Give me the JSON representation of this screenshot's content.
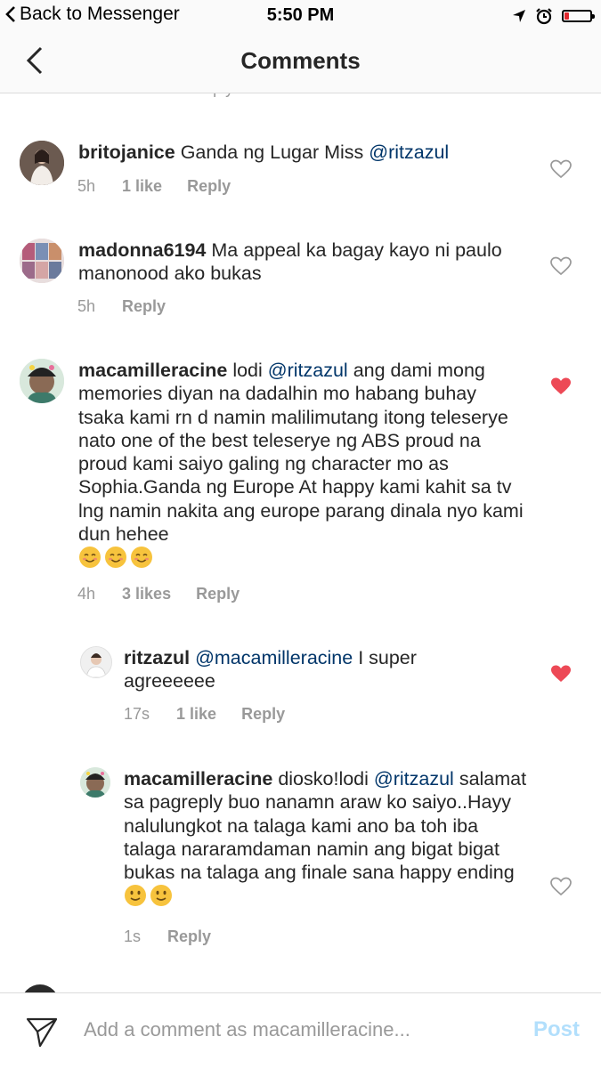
{
  "status_bar": {
    "back_label": "Back to Messenger",
    "time": "5:50 PM"
  },
  "header": {
    "title": "Comments"
  },
  "peek": {
    "ts": "5h",
    "likes": "1 like",
    "reply": "Reply"
  },
  "comments": [
    {
      "username": "britojanice",
      "text_before": "Ganda ng Lugar Miss ",
      "mention": "@ritzazul",
      "text_after": "",
      "time": "5h",
      "likes": "1 like",
      "reply_label": "Reply",
      "liked": false
    },
    {
      "username": "madonna6194",
      "text_before": "Ma appeal ka bagay kayo ni paulo manonood ako bukas",
      "mention": "",
      "text_after": "",
      "time": "5h",
      "likes": "",
      "reply_label": "Reply",
      "liked": false
    },
    {
      "username": "macamilleracine",
      "text_before": "lodi ",
      "mention": "@ritzazul",
      "text_after": " ang dami mong memories diyan na dadalhin mo habang buhay tsaka kami rn d namin malilimutang itong teleserye nato one of the best teleserye ng ABS proud na proud kami saiyo galing ng character mo as Sophia.Ganda ng Europe At happy kami kahit sa tv lng namin nakita ang europe parang dinala nyo kami dun hehee",
      "emojis": [
        "smiling-face",
        "smiling-face",
        "smiling-face"
      ],
      "time": "4h",
      "likes": "3 likes",
      "reply_label": "Reply",
      "liked": true
    },
    {
      "username": "ritzazul",
      "text_before": "",
      "mention": "@macamilleracine",
      "text_after": " I super agreeeeee",
      "time": "17s",
      "likes": "1 like",
      "reply_label": "Reply",
      "liked": true,
      "is_reply": true
    },
    {
      "username": "macamilleracine",
      "text_before": "diosko!lodi ",
      "mention": "@ritzazul",
      "text_after": " salamat sa pagreply buo nanamn araw ko saiyo..Hayy nalulungkot na talaga kami ano ba toh iba talaga nararamdaman namin ang bigat bigat bukas na talaga ang finale sana happy ending",
      "emojis": [
        "slight-smile",
        "slight-smile"
      ],
      "time": "1s",
      "likes": "",
      "reply_label": "Reply",
      "liked": false,
      "is_reply": true
    }
  ],
  "composer": {
    "placeholder": "Add a comment as macamilleracine...",
    "post_label": "Post"
  },
  "colors": {
    "mention": "#003569",
    "heart_liked": "#ed4956",
    "meta": "#999999",
    "post_disabled": "#b2dffc"
  }
}
